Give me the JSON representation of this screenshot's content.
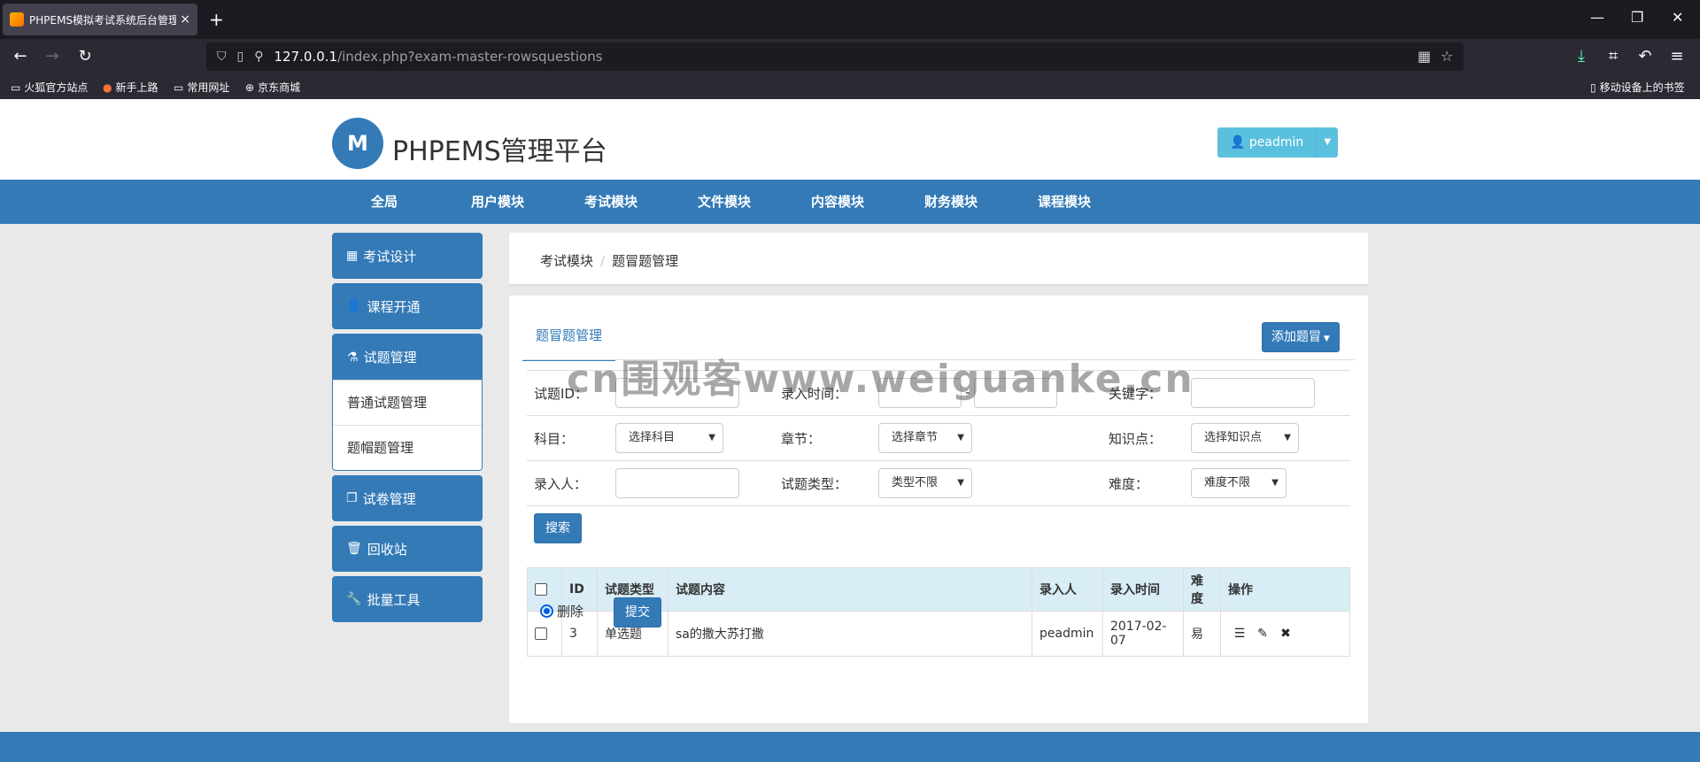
{
  "browser": {
    "tab_title": "PHPEMS模拟考试系统后台管理",
    "tab_close": "×",
    "new_tab": "+",
    "url_host": "127.0.0.1",
    "url_path": "/index.php?exam-master-rowsquestions",
    "bookmarks": [
      "火狐官方站点",
      "新手上路",
      "常用网址",
      "京东商城"
    ],
    "mobile_bookmarks": "移动设备上的书签"
  },
  "header": {
    "logo_text": "M",
    "brand": "PHPEMS管理平台",
    "user": "peadmin"
  },
  "mainnav": [
    "全局",
    "用户模块",
    "考试模块",
    "文件模块",
    "内容模块",
    "财务模块",
    "课程模块"
  ],
  "sidebar": {
    "items": [
      {
        "label": "考试设计"
      },
      {
        "label": "课程开通"
      },
      {
        "label": "试题管理"
      },
      {
        "label": "试卷管理"
      },
      {
        "label": "回收站"
      },
      {
        "label": "批量工具"
      }
    ],
    "sub": [
      "普通试题管理",
      "题帽题管理"
    ]
  },
  "breadcrumb": {
    "parent": "考试模块",
    "sep": "/",
    "current": "题冒题管理"
  },
  "panel": {
    "tab": "题冒题管理",
    "add_button": "添加题冒"
  },
  "filters": {
    "id_label": "试题ID：",
    "time_label": "录入时间：",
    "time_sep": "-",
    "keyword_label": "关键字：",
    "subject_label": "科目：",
    "subject_value": "选择科目",
    "chapter_label": "章节：",
    "chapter_value": "选择章节",
    "point_label": "知识点：",
    "point_value": "选择知识点",
    "author_label": "录入人：",
    "type_label": "试题类型：",
    "type_value": "类型不限",
    "difficulty_label": "难度：",
    "difficulty_value": "难度不限",
    "search_button": "搜索"
  },
  "table": {
    "headers": [
      "ID",
      "试题类型",
      "试题内容",
      "录入人",
      "录入时间",
      "难度",
      "操作"
    ],
    "rows": [
      {
        "id": "3",
        "type": "单选题",
        "content": "sa的撒大苏打撒",
        "author": "peadmin",
        "date": "2017-02-07",
        "difficulty": "易"
      }
    ]
  },
  "bulk": {
    "radio_label": "删除",
    "submit_button": "提交"
  },
  "watermark": "cn围观客www.weiguanke.cn",
  "colors": {
    "primary": "#337ab7",
    "info": "#5bc0de",
    "table_head": "#d9edf7"
  }
}
